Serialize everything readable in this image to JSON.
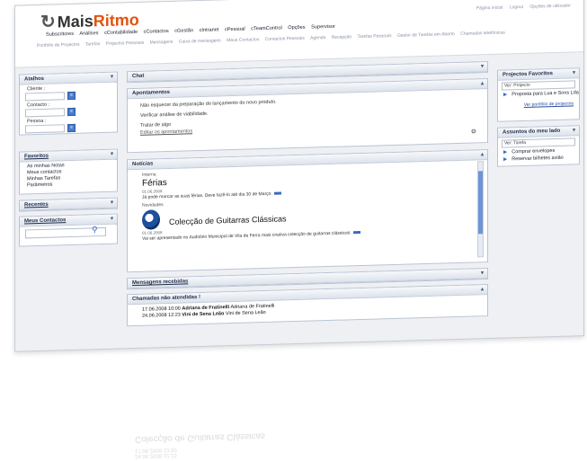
{
  "header": {
    "logo_prefix": "Mais",
    "logo_accent": "Ritmo",
    "nav": [
      "Subscritores",
      "Análises",
      "cContabilidade",
      "cContactos",
      "cGestão",
      "cIntranet",
      "cPessoal",
      "cTeamControl",
      "Opções",
      "Supervisor"
    ],
    "quick_links": [
      "Portfólio de Projectos",
      "Tarefas",
      "Projectos Pessoais",
      "Mensagens",
      "Caixa de mensagens",
      "Meus Contactos",
      "Contactos Pessoais",
      "Agenda",
      "Recepção",
      "Tarefas Pessoais",
      "Gestor de Tarefas em Aberto",
      "Chamadas telefónicas"
    ],
    "top_links": [
      "Página inicial",
      "Logout",
      "Opções de utilizador"
    ]
  },
  "sidebar_left": {
    "atalhos": {
      "title": "Atalhos",
      "fields": [
        {
          "label": "Cliente :"
        },
        {
          "label": "Contacto :"
        },
        {
          "label": "Pessoa :"
        }
      ]
    },
    "favoritos": {
      "title": "Favoritos",
      "items": [
        "As minhas Notas",
        "Meus contactos",
        "Minhas Tarefas",
        "Parâmetros"
      ]
    },
    "recentes": {
      "title": "Recentes"
    },
    "meus_contactos": {
      "title": "Meus Contactos"
    }
  },
  "main": {
    "chat": {
      "title": "Chat"
    },
    "apontamentos": {
      "title": "Apontamentos",
      "items": [
        "Não esquecer da preparação do lançamento do novo produto.",
        "Verificar análise de viabilidade.",
        "Tratar de algo"
      ],
      "edit_link": "Editar os apontamentos"
    },
    "noticias": {
      "title": "Notícias",
      "items": [
        {
          "category": "Interna",
          "title": "Férias",
          "date": "01.06.2008",
          "text": "Já pode marcar as suas férias. Deve fazê-lo até dia 30 de Março."
        },
        {
          "category": "Novidades",
          "title": "Colecção de Guitarras Clássicas",
          "date": "01.06.2008",
          "text": "Vai ser apresentado no Auditório Municipal de Vila de Ferra mais criativa colecção de guitarras clássicas."
        }
      ]
    },
    "mensagens": {
      "title": "Mensagens recebidas"
    },
    "chamadas": {
      "title": "Chamadas não atendidas !",
      "items": [
        {
          "datetime": "17.06.2008 10:00",
          "name": "Adriana de Fratinelli",
          "org": "Adriana de Fratinelli"
        },
        {
          "datetime": "24.06.2008 12:23",
          "name": "Vini de Sena Leão",
          "org": "Vini de Sena Leão"
        }
      ]
    }
  },
  "sidebar_right": {
    "projectos": {
      "title": "Projectos Favoritos",
      "select": "Ver: Projecto",
      "items": [
        "Proposta para Lua e Sons Lda"
      ],
      "link": "Ver portfólio de projectos"
    },
    "assuntos": {
      "title": "Assuntos do meu lado",
      "select": "Ver: Tarefa",
      "items": [
        "Comprar envelopes",
        "Reservar bilhetes avião"
      ]
    }
  }
}
